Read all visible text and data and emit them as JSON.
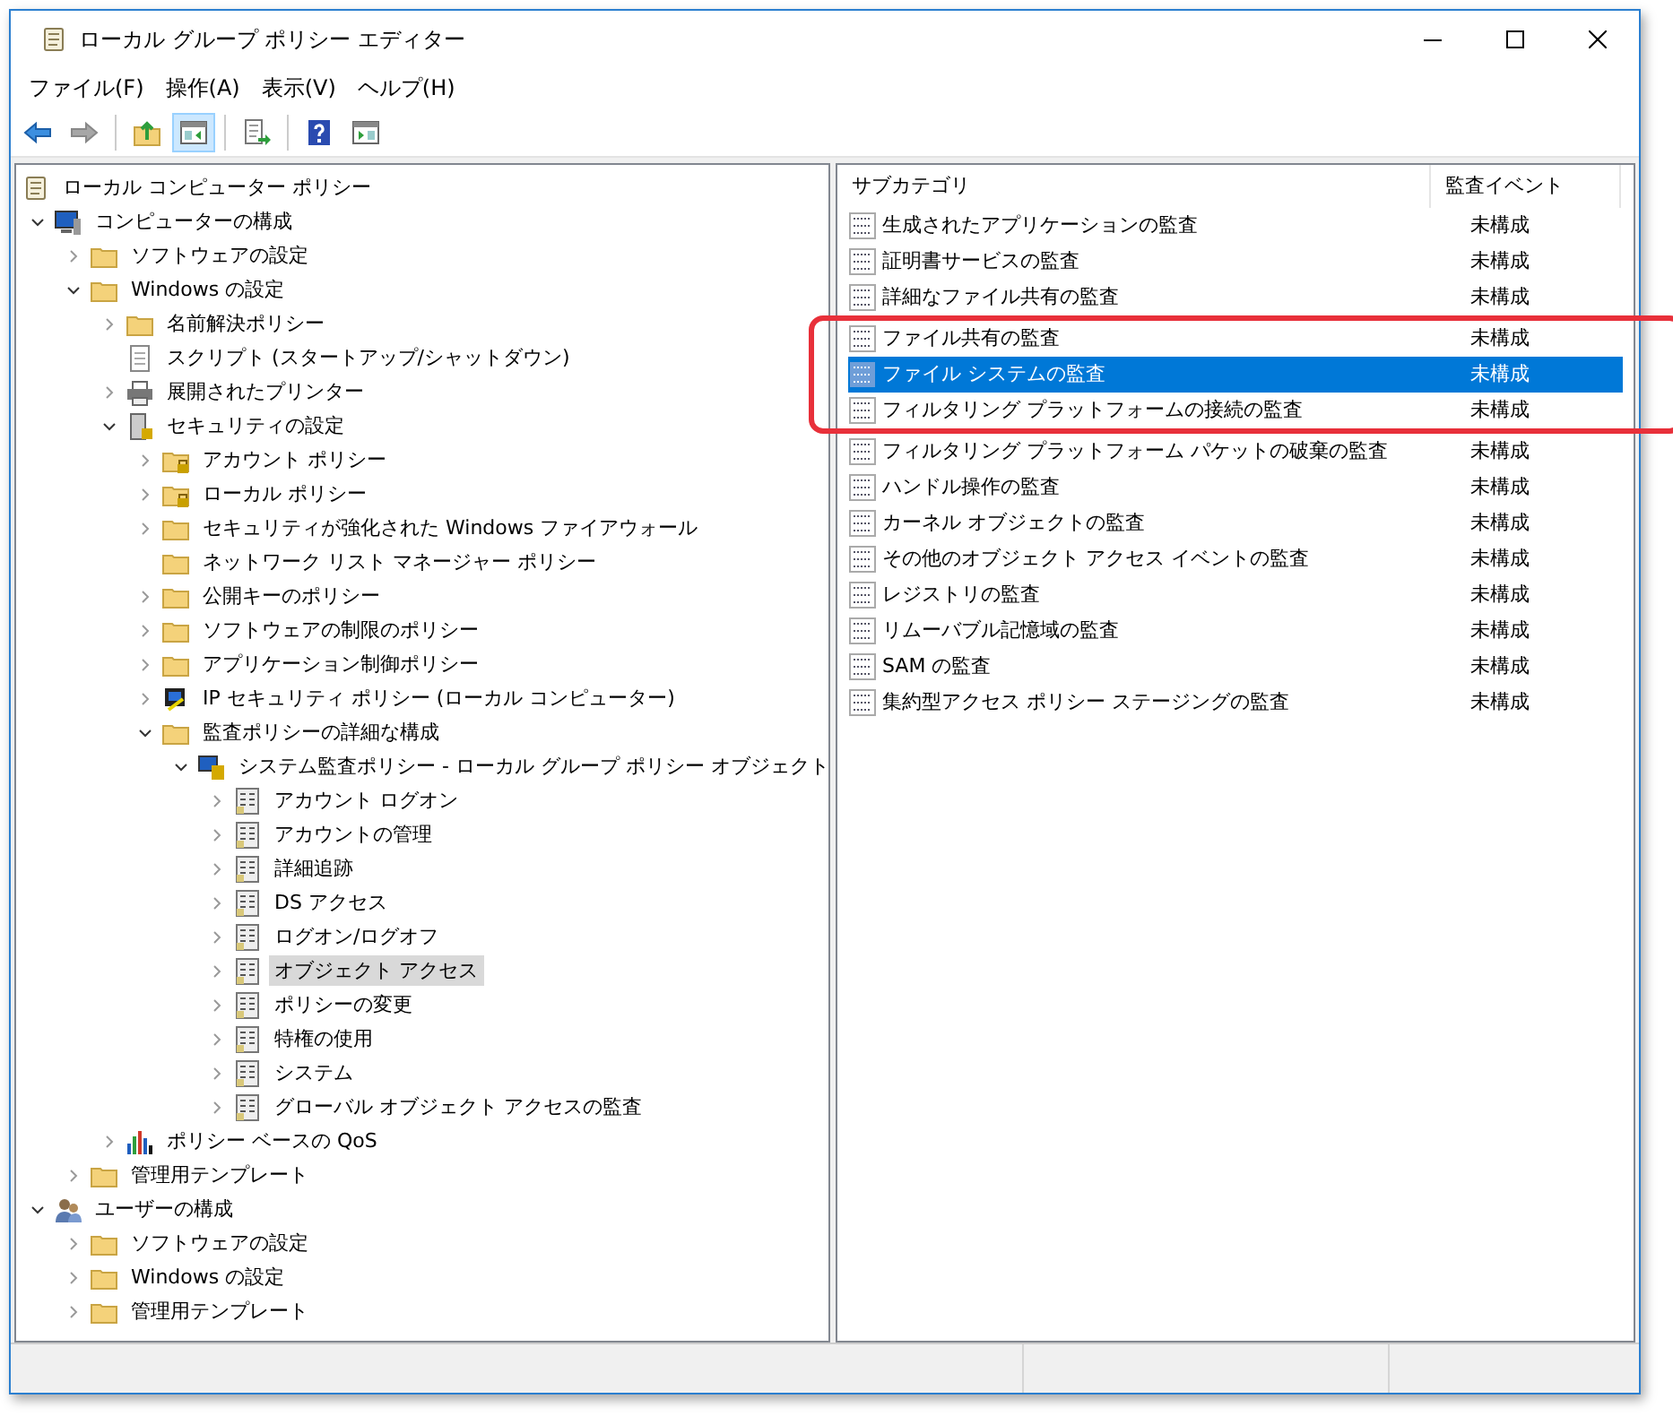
{
  "window": {
    "title": "ローカル グループ ポリシー エディター"
  },
  "menu": [
    "ファイル(F)",
    "操作(A)",
    "表示(V)",
    "ヘルプ(H)"
  ],
  "toolbar": [
    {
      "kind": "back",
      "disabled": false,
      "pressed": false
    },
    {
      "kind": "forward",
      "disabled": true,
      "pressed": false
    },
    {
      "kind": "sep"
    },
    {
      "kind": "up",
      "disabled": false,
      "pressed": false
    },
    {
      "kind": "tree",
      "disabled": false,
      "pressed": true
    },
    {
      "kind": "sep"
    },
    {
      "kind": "export",
      "disabled": false,
      "pressed": false
    },
    {
      "kind": "sep"
    },
    {
      "kind": "help",
      "disabled": false,
      "pressed": false
    },
    {
      "kind": "pane",
      "disabled": false,
      "pressed": false
    }
  ],
  "tree": [
    {
      "label": "ローカル コンピューター ポリシー",
      "kind": "policy",
      "selected": false,
      "children": [
        {
          "label": "コンピューターの構成",
          "kind": "computer",
          "expanded": true,
          "selected": false,
          "children": [
            {
              "label": "ソフトウェアの設定",
              "kind": "folder",
              "expanded": false,
              "selected": false
            },
            {
              "label": "Windows の設定",
              "kind": "folder",
              "expanded": true,
              "selected": false,
              "children": [
                {
                  "label": "名前解決ポリシー",
                  "kind": "folder",
                  "expanded": false,
                  "selected": false
                },
                {
                  "label": "スクリプト (スタートアップ/シャットダウン)",
                  "kind": "script",
                  "selected": false
                },
                {
                  "label": "展開されたプリンター",
                  "kind": "printer",
                  "expanded": false,
                  "selected": false
                },
                {
                  "label": "セキュリティの設定",
                  "kind": "security",
                  "expanded": true,
                  "selected": false,
                  "children": [
                    {
                      "label": "アカウント ポリシー",
                      "kind": "lockfolder",
                      "expanded": false,
                      "selected": false
                    },
                    {
                      "label": "ローカル ポリシー",
                      "kind": "lockfolder",
                      "expanded": false,
                      "selected": false
                    },
                    {
                      "label": "セキュリティが強化された Windows ファイアウォール",
                      "kind": "folder",
                      "expanded": false,
                      "selected": false
                    },
                    {
                      "label": "ネットワーク リスト マネージャー ポリシー",
                      "kind": "folder",
                      "selected": false
                    },
                    {
                      "label": "公開キーのポリシー",
                      "kind": "folder",
                      "expanded": false,
                      "selected": false
                    },
                    {
                      "label": "ソフトウェアの制限のポリシー",
                      "kind": "folder",
                      "expanded": false,
                      "selected": false
                    },
                    {
                      "label": "アプリケーション制御ポリシー",
                      "kind": "folder",
                      "expanded": false,
                      "selected": false
                    },
                    {
                      "label": "IP セキュリティ ポリシー (ローカル コンピューター)",
                      "kind": "ip",
                      "expanded": false,
                      "selected": false
                    },
                    {
                      "label": "監査ポリシーの詳細な構成",
                      "kind": "folder",
                      "expanded": true,
                      "selected": false,
                      "children": [
                        {
                          "label": "システム監査ポリシー - ローカル グループ ポリシー オブジェクト",
                          "kind": "audit",
                          "expanded": true,
                          "selected": false,
                          "children": [
                            {
                              "label": "アカウント ログオン",
                              "kind": "auditcat",
                              "expanded": false,
                              "selected": false
                            },
                            {
                              "label": "アカウントの管理",
                              "kind": "auditcat",
                              "expanded": false,
                              "selected": false
                            },
                            {
                              "label": "詳細追跡",
                              "kind": "auditcat",
                              "expanded": false,
                              "selected": false
                            },
                            {
                              "label": "DS アクセス",
                              "kind": "auditcat",
                              "expanded": false,
                              "selected": false
                            },
                            {
                              "label": "ログオン/ログオフ",
                              "kind": "auditcat",
                              "expanded": false,
                              "selected": false
                            },
                            {
                              "label": "オブジェクト アクセス",
                              "kind": "auditcat",
                              "expanded": false,
                              "selected": true
                            },
                            {
                              "label": "ポリシーの変更",
                              "kind": "auditcat",
                              "expanded": false,
                              "selected": false
                            },
                            {
                              "label": "特権の使用",
                              "kind": "auditcat",
                              "expanded": false,
                              "selected": false
                            },
                            {
                              "label": "システム",
                              "kind": "auditcat",
                              "expanded": false,
                              "selected": false
                            },
                            {
                              "label": "グローバル オブジェクト アクセスの監査",
                              "kind": "auditcat",
                              "expanded": false,
                              "selected": false
                            }
                          ]
                        }
                      ]
                    }
                  ]
                },
                {
                  "label": "ポリシー ベースの QoS",
                  "kind": "qos",
                  "expanded": false,
                  "selected": false
                }
              ]
            },
            {
              "label": "管理用テンプレート",
              "kind": "folder",
              "expanded": false,
              "selected": false
            }
          ]
        },
        {
          "label": "ユーザーの構成",
          "kind": "user",
          "expanded": true,
          "selected": false,
          "children": [
            {
              "label": "ソフトウェアの設定",
              "kind": "folder",
              "expanded": false,
              "selected": false
            },
            {
              "label": "Windows の設定",
              "kind": "folder",
              "expanded": false,
              "selected": false
            },
            {
              "label": "管理用テンプレート",
              "kind": "folder",
              "expanded": false,
              "selected": false
            }
          ]
        }
      ]
    }
  ],
  "list": {
    "columns": [
      "サブカテゴリ",
      "監査イベント"
    ],
    "rows": [
      {
        "name": "生成されたアプリケーションの監査",
        "event": "未構成",
        "selected": false,
        "framed": false
      },
      {
        "name": "証明書サービスの監査",
        "event": "未構成",
        "selected": false,
        "framed": false
      },
      {
        "name": "詳細なファイル共有の監査",
        "event": "未構成",
        "selected": false,
        "framed": false
      },
      {
        "name": "ファイル共有の監査",
        "event": "未構成",
        "selected": false,
        "framed": true
      },
      {
        "name": "ファイル システムの監査",
        "event": "未構成",
        "selected": true,
        "framed": true
      },
      {
        "name": "フィルタリング プラットフォームの接続の監査",
        "event": "未構成",
        "selected": false,
        "framed": true
      },
      {
        "name": "フィルタリング プラットフォーム パケットの破棄の監査",
        "event": "未構成",
        "selected": false,
        "framed": false
      },
      {
        "name": "ハンドル操作の監査",
        "event": "未構成",
        "selected": false,
        "framed": false
      },
      {
        "name": "カーネル オブジェクトの監査",
        "event": "未構成",
        "selected": false,
        "framed": false
      },
      {
        "name": "その他のオブジェクト アクセス イベントの監査",
        "event": "未構成",
        "selected": false,
        "framed": false
      },
      {
        "name": "レジストリの監査",
        "event": "未構成",
        "selected": false,
        "framed": false
      },
      {
        "name": "リムーバブル記憶域の監査",
        "event": "未構成",
        "selected": false,
        "framed": false
      },
      {
        "name": "SAM の監査",
        "event": "未構成",
        "selected": false,
        "framed": false
      },
      {
        "name": "集約型アクセス ポリシー ステージングの監査",
        "event": "未構成",
        "selected": false,
        "framed": false
      }
    ]
  }
}
